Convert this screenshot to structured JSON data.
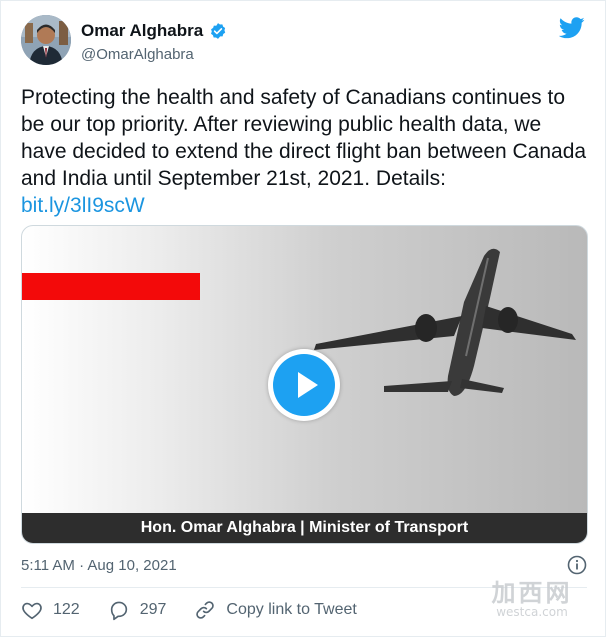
{
  "user": {
    "name": "Omar Alghabra",
    "handle": "@OmarAlghabra"
  },
  "tweet": {
    "text": "Protecting the health and safety of Canadians continues to be our top priority. After reviewing public health data, we have decided to extend the direct flight ban between Canada and India until September 21st, 2021. Details:",
    "link": "bit.ly/3lI9scW"
  },
  "media": {
    "caption": "Hon. Omar Alghabra | Minister of Transport",
    "accent_color": "#f30a0a",
    "play_color": "#1da1f2"
  },
  "meta": {
    "timestamp": "5:11 AM · Aug 10, 2021"
  },
  "actions": {
    "likes": "122",
    "replies": "297",
    "copy_link_label": "Copy link to Tweet"
  },
  "watermark": {
    "cn": "加西网",
    "en": "westca.com"
  },
  "icons": [
    "verified-icon",
    "twitter-bird-icon",
    "play-icon",
    "info-icon",
    "heart-icon",
    "reply-icon",
    "link-icon"
  ]
}
